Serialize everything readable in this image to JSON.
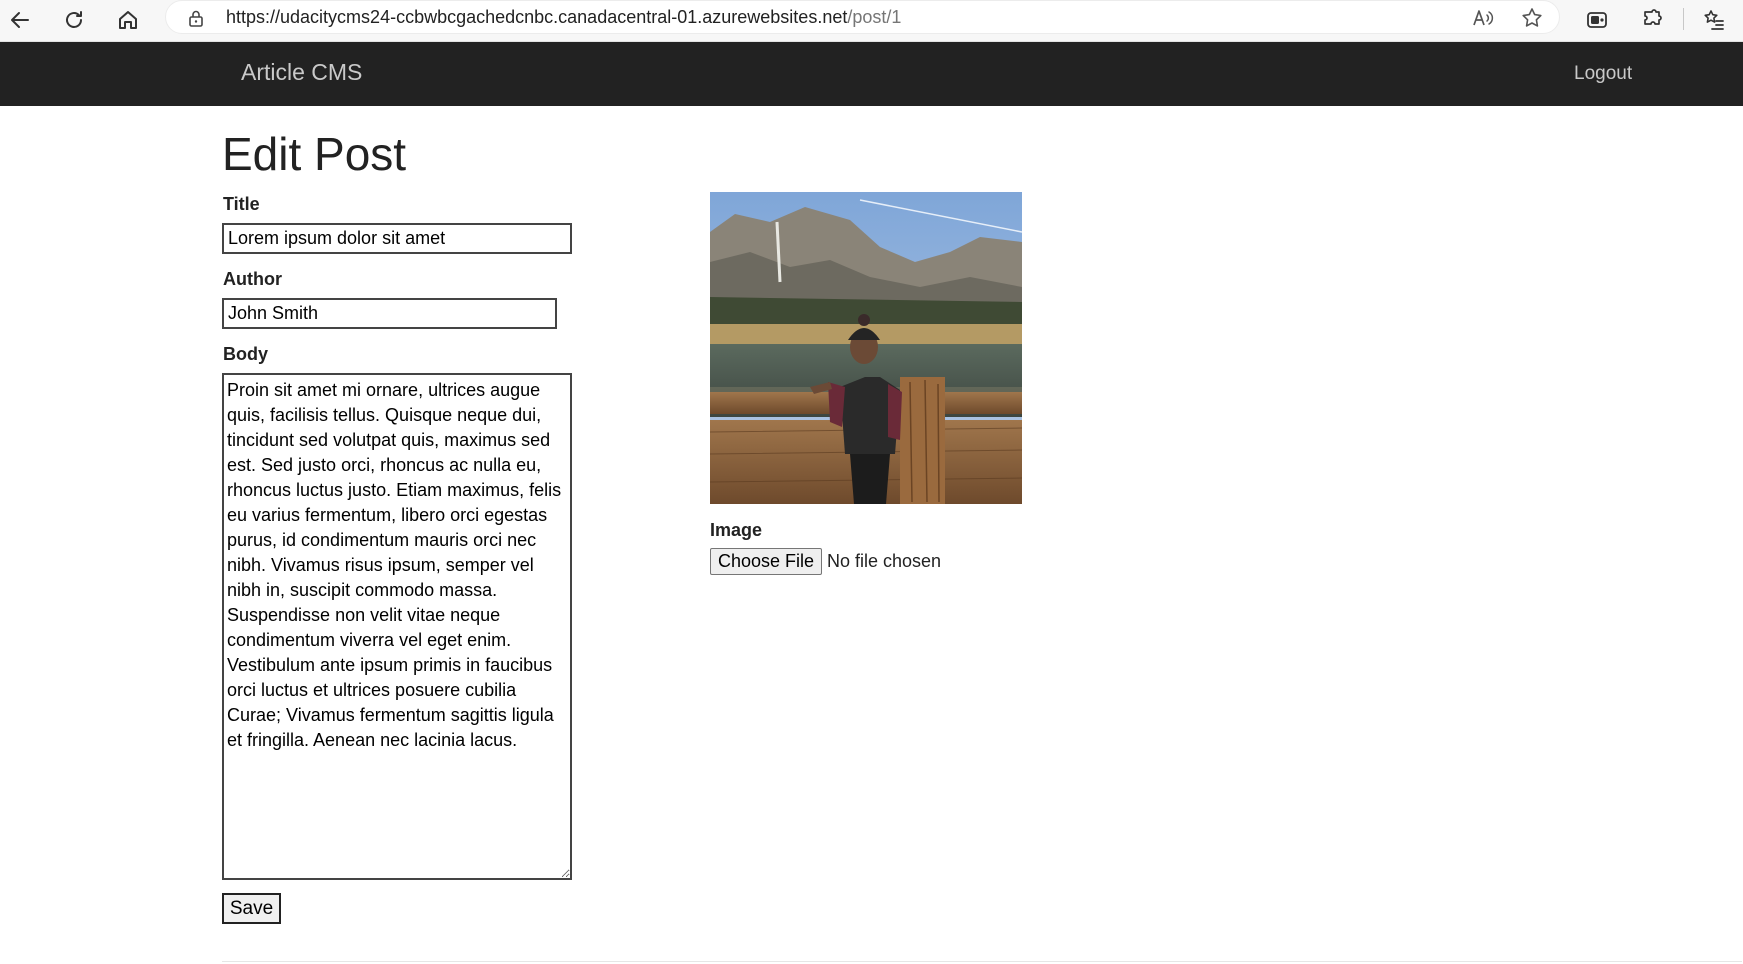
{
  "browser": {
    "url_host": "https://udacitycms24-ccbwbcgachedcnbc.canadacentral-01.azurewebsites.net",
    "url_path": "/post/1",
    "icons": [
      "back-arrow-icon",
      "refresh-icon",
      "home-icon",
      "lock-icon",
      "read-aloud-icon",
      "favorite-star-icon",
      "copilot-icon",
      "extensions-icon",
      "favorites-list-icon"
    ]
  },
  "navbar": {
    "brand": "Article CMS",
    "logout": "Logout",
    "background": "#222222"
  },
  "page": {
    "title": "Edit Post"
  },
  "form": {
    "title_label": "Title",
    "title_value": "Lorem ipsum dolor sit amet",
    "author_label": "Author",
    "author_value": "John Smith",
    "body_label": "Body",
    "body_value": "Proin sit amet mi ornare, ultrices augue quis, facilisis tellus. Quisque neque dui, tincidunt sed volutpat quis, maximus sed est. Sed justo orci, rhoncus ac nulla eu, rhoncus luctus justo. Etiam maximus, felis eu varius fermentum, libero orci egestas purus, id condimentum mauris orci nec nibh. Vivamus risus ipsum, semper vel nibh in, suscipit commodo massa. Suspendisse non velit vitae neque condimentum viverra vel eget enim. Vestibulum ante ipsum primis in faucibus orci luctus et ultrices posuere cubilia Curae; Vivamus fermentum sagittis ligula et fringilla. Aenean nec lacinia lacus.",
    "save_label": "Save"
  },
  "image_section": {
    "label": "Image",
    "choose_file_label": "Choose File",
    "file_status": "No file chosen"
  }
}
